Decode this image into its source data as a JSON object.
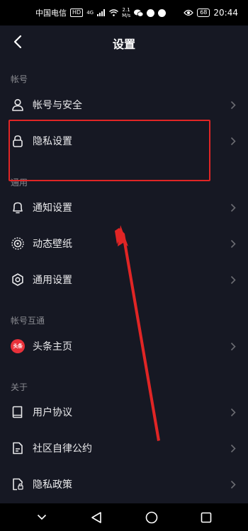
{
  "status_bar": {
    "carrier": "中国电信",
    "hd_badge": "HD",
    "network": "4G",
    "speed_value": "2.1",
    "speed_unit": "M/s",
    "battery": "68",
    "time": "20:44"
  },
  "header": {
    "title": "设置"
  },
  "sections": {
    "account": {
      "title": "帐号",
      "items": [
        {
          "label": "帐号与安全",
          "icon": "person-icon"
        },
        {
          "label": "隐私设置",
          "icon": "lock-icon"
        }
      ]
    },
    "general": {
      "title": "通用",
      "items": [
        {
          "label": "通知设置",
          "icon": "bell-icon"
        },
        {
          "label": "动态壁纸",
          "icon": "wallpaper-icon"
        },
        {
          "label": "通用设置",
          "icon": "gear-icon"
        }
      ]
    },
    "linked": {
      "title": "帐号互通",
      "items": [
        {
          "label": "头条主页",
          "icon": "toutiao-icon",
          "icon_text": "头条"
        }
      ]
    },
    "about": {
      "title": "关于",
      "items": [
        {
          "label": "用户协议",
          "icon": "book-icon"
        },
        {
          "label": "社区自律公约",
          "icon": "document-icon"
        },
        {
          "label": "隐私政策",
          "icon": "privacy-doc-icon"
        }
      ]
    }
  },
  "colors": {
    "background": "#161823",
    "annotation": "#e02525",
    "toutiao": "#e8313a"
  }
}
